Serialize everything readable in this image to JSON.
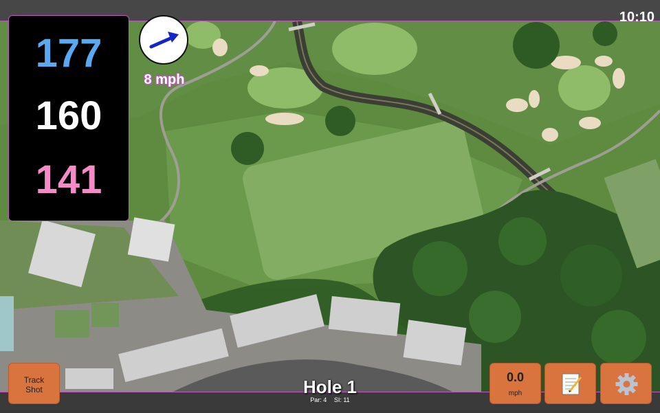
{
  "clock": "10:10",
  "distances": {
    "back": "177",
    "middle": "160",
    "front": "141"
  },
  "wind": {
    "speed_label": "8 mph",
    "direction_icon": "wind-arrow-icon"
  },
  "buttons": {
    "track_shot_line1": "Track",
    "track_shot_line2": "Shot",
    "speed_value": "0.0",
    "speed_unit": "mph",
    "notes_icon": "notepad-icon",
    "settings_icon": "gear-icon"
  },
  "hole": {
    "title": "Hole 1",
    "par": "Par: 4",
    "si": "SI: 11"
  },
  "colors": {
    "back": "#5aa8f0",
    "middle": "#ffffff",
    "front": "#f48ac6",
    "button": "#d9743f",
    "accent": "#c05ac0"
  }
}
